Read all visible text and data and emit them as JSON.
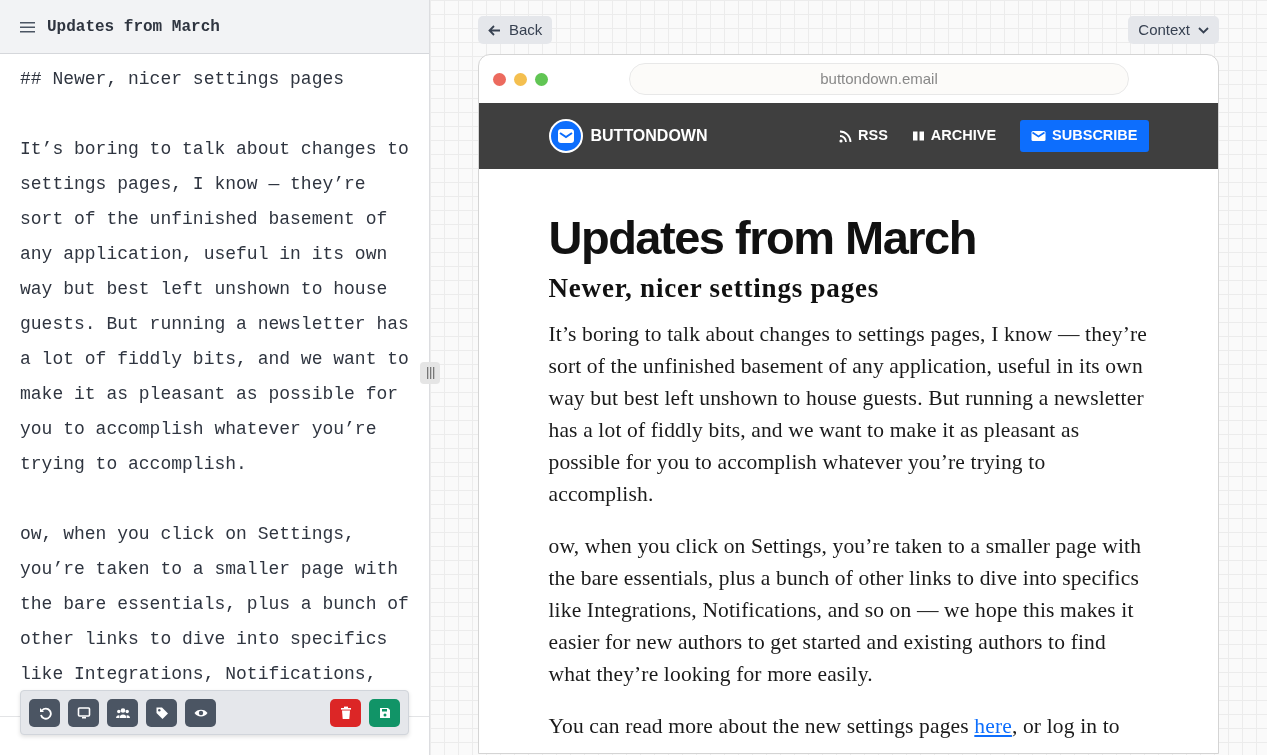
{
  "editor": {
    "title": "Updates from March",
    "paragraphs": [
      "## Newer, nicer settings pages",
      "It’s boring to talk about changes to settings pages, I know — they’re sort of the unfinished basement of any application, useful in its own way but best left unshown to house guests. But running a newsletter has a lot of fiddly bits, and we want to make it as pleasant as possible for you to accomplish whatever you’re trying to accomplish.",
      "ow, when you click on Settings, you’re taken to a smaller page with the bare essentials, plus a bunch of other links to dive into specifics like Integrations, Notifications,"
    ],
    "toolbar": [
      {
        "kind": "undo"
      },
      {
        "kind": "desktop"
      },
      {
        "kind": "people"
      },
      {
        "kind": "tag"
      },
      {
        "kind": "eye"
      },
      {
        "kind": "delete"
      },
      {
        "kind": "save"
      }
    ]
  },
  "preview": {
    "back_button": "Back",
    "context_menu": "Context",
    "browser": {
      "url": "buttondown.email"
    },
    "site": {
      "brand": "BUTTONDOWN",
      "nav": [
        {
          "kind": "rss",
          "label": "RSS"
        },
        {
          "kind": "archive",
          "label": "ARCHIVE"
        },
        {
          "kind": "subscribe",
          "label": "SUBSCRIBE"
        }
      ]
    },
    "article": {
      "title": "Updates from March",
      "subtitle": "Newer, nicer settings pages",
      "paragraphs": [
        [
          {
            "kind": "text",
            "text": "It’s boring to talk about changes to settings pages, I know — they’re sort of the unfinished basement of any application, useful in its own way but best left unshown to house guests. But running a newsletter has a lot of fiddly bits, and we want to make it as pleasant as possible for you to accomplish whatever you’re trying to accomplish."
          }
        ],
        [
          {
            "kind": "text",
            "text": "ow, when you click on Settings, you’re taken to a smaller page with the bare essentials, plus a bunch of other links to dive into specifics like Integrations, Notifications, and so on — we hope this makes it easier for new authors to get started and existing authors to find what they’re looking for more easily."
          }
        ],
        [
          {
            "kind": "text",
            "text": "You can read more about the new settings pages "
          },
          {
            "kind": "link",
            "text": "here"
          },
          {
            "kind": "text",
            "text": ", or log in to"
          }
        ]
      ]
    }
  }
}
